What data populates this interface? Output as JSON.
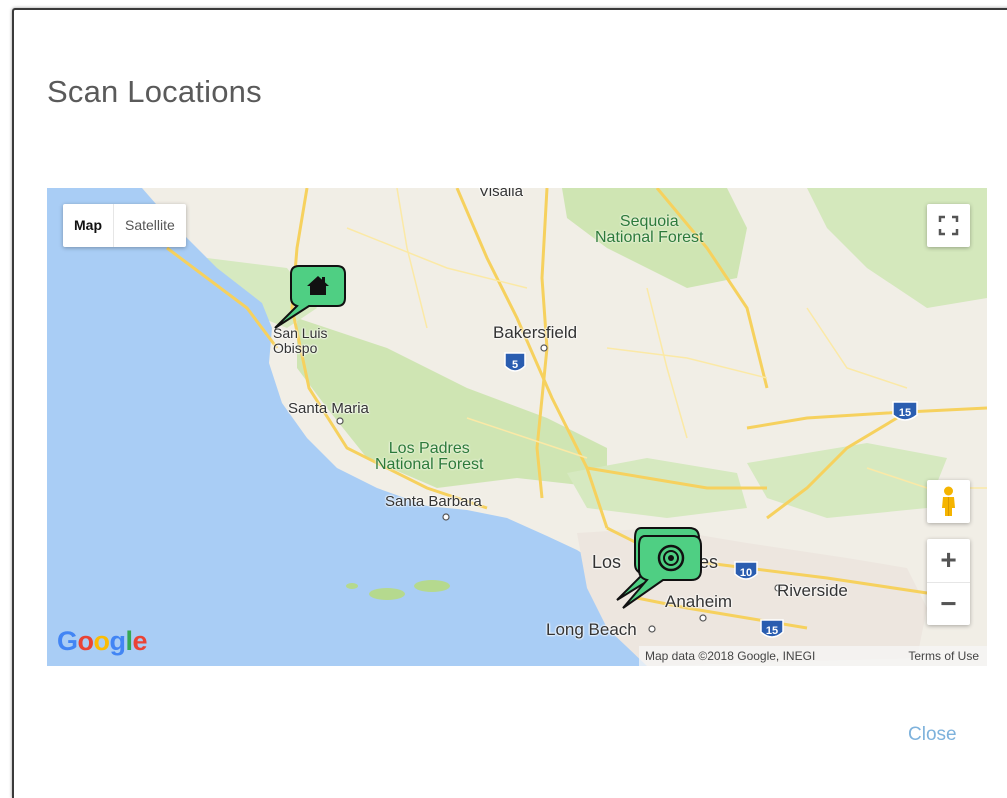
{
  "dialog": {
    "title": "Scan Locations",
    "close_label": "Close"
  },
  "map": {
    "map_type": {
      "map_label": "Map",
      "satellite_label": "Satellite",
      "selected": "Map"
    },
    "labels": {
      "visalia": "Visalia",
      "sequoia_1": "Sequoia",
      "sequoia_2": "National Forest",
      "bakersfield": "Bakersfield",
      "san_luis_1": "San Luis",
      "san_luis_2": "Obispo",
      "santa_maria": "Santa Maria",
      "los_padres_1": "Los Padres",
      "los_padres_2": "National Forest",
      "santa_barbara": "Santa Barbara",
      "los_angeles_a": "Los",
      "los_angeles_b": "es",
      "anaheim": "Anaheim",
      "riverside": "Riverside",
      "long_beach": "Long Beach"
    },
    "shields": {
      "i5": "5",
      "i15": "15",
      "i10": "10",
      "i15b": "15"
    },
    "markers": [
      {
        "icon": "home-icon",
        "place": "San Luis Obispo"
      },
      {
        "icon": "target-icon",
        "place": "Los Angeles"
      }
    ],
    "controls": {
      "fullscreen_icon": "fullscreen-icon",
      "pegman_icon": "pegman-icon",
      "zoom_in": "+",
      "zoom_out": "−"
    },
    "logo": {
      "g1": "G",
      "g2": "o",
      "g3": "o",
      "g4": "g",
      "g5": "l",
      "g6": "e"
    },
    "attribution": "Map data ©2018 Google, INEGI",
    "terms": "Terms of Use",
    "colors": {
      "water": "#a9cdf5",
      "land": "#f1eee6",
      "park": "#c9e3ae",
      "highway": "#f7d76a",
      "marker": "#4fcf83"
    }
  }
}
